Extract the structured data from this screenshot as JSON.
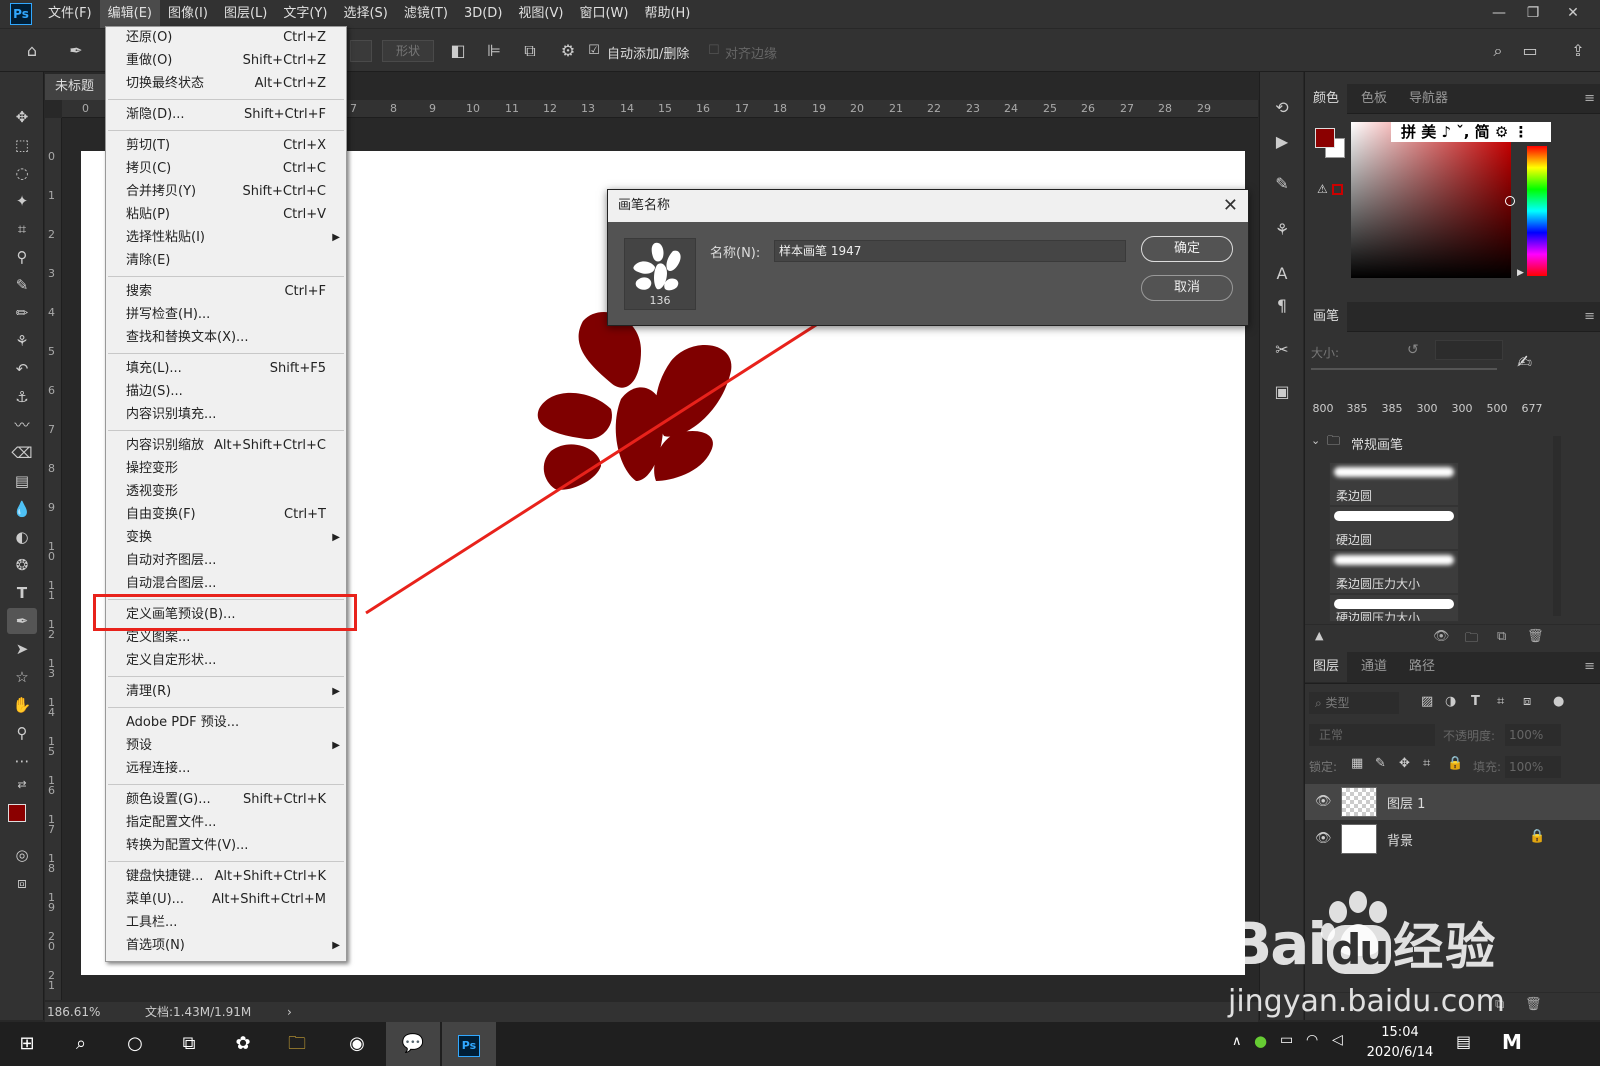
{
  "menubar": {
    "logo": "Ps",
    "items": [
      "文件(F)",
      "编辑(E)",
      "图像(I)",
      "图层(L)",
      "文字(Y)",
      "选择(S)",
      "滤镜(T)",
      "3D(D)",
      "视图(V)",
      "窗口(W)",
      "帮助(H)"
    ],
    "active_index": 1
  },
  "options": {
    "path_label": "形状",
    "auto_add_delete": "自动添加/删除",
    "align_edges": "对齐边缘"
  },
  "document": {
    "tab_title": "未标题",
    "zoom": "186.61%",
    "doc_info": "文档:1.43M/1.91M",
    "ruler_h": [
      "0",
      "7",
      "8",
      "9",
      "10",
      "11",
      "12",
      "13",
      "14",
      "15",
      "16",
      "17",
      "18",
      "19",
      "20",
      "21",
      "22",
      "23",
      "24",
      "25",
      "26",
      "27",
      "28",
      "29"
    ],
    "ruler_v": [
      "0",
      "1",
      "2",
      "3",
      "4",
      "5",
      "6",
      "7",
      "8",
      "9",
      "1 0",
      "1 1",
      "1 2",
      "1 3",
      "1 4",
      "1 5",
      "1 6",
      "1 7",
      "1 8",
      "1 9",
      "2 0",
      "2 1"
    ]
  },
  "edit_menu": {
    "groups": [
      [
        [
          "还原(O)",
          "Ctrl+Z"
        ],
        [
          "重做(O)",
          "Shift+Ctrl+Z"
        ],
        [
          "切换最终状态",
          "Alt+Ctrl+Z"
        ]
      ],
      [
        [
          "渐隐(D)...",
          "Shift+Ctrl+F"
        ]
      ],
      [
        [
          "剪切(T)",
          "Ctrl+X"
        ],
        [
          "拷贝(C)",
          "Ctrl+C"
        ],
        [
          "合并拷贝(Y)",
          "Shift+Ctrl+C"
        ],
        [
          "粘贴(P)",
          "Ctrl+V"
        ],
        [
          "选择性粘贴(I)",
          ""
        ],
        [
          "清除(E)",
          ""
        ]
      ],
      [
        [
          "搜索",
          "Ctrl+F"
        ],
        [
          "拼写检查(H)...",
          ""
        ],
        [
          "查找和替换文本(X)...",
          ""
        ]
      ],
      [
        [
          "填充(L)...",
          "Shift+F5"
        ],
        [
          "描边(S)...",
          ""
        ],
        [
          "内容识别填充...",
          ""
        ]
      ],
      [
        [
          "内容识别缩放",
          "Alt+Shift+Ctrl+C"
        ],
        [
          "操控变形",
          ""
        ],
        [
          "透视变形",
          ""
        ],
        [
          "自由变换(F)",
          "Ctrl+T"
        ],
        [
          "变换",
          ""
        ],
        [
          "自动对齐图层...",
          ""
        ],
        [
          "自动混合图层...",
          ""
        ]
      ],
      [
        [
          "定义画笔预设(B)...",
          ""
        ],
        [
          "定义图案...",
          ""
        ],
        [
          "定义自定形状...",
          ""
        ]
      ],
      [
        [
          "清理(R)",
          ""
        ]
      ],
      [
        [
          "Adobe PDF 预设...",
          ""
        ],
        [
          "预设",
          ""
        ],
        [
          "远程连接...",
          ""
        ]
      ],
      [
        [
          "颜色设置(G)...",
          "Shift+Ctrl+K"
        ],
        [
          "指定配置文件...",
          ""
        ],
        [
          "转换为配置文件(V)...",
          ""
        ]
      ],
      [
        [
          "键盘快捷键...",
          "Alt+Shift+Ctrl+K"
        ],
        [
          "菜单(U)...",
          "Alt+Shift+Ctrl+M"
        ],
        [
          "工具栏...",
          ""
        ],
        [
          "首选项(N)",
          ""
        ]
      ]
    ],
    "submenu_items": [
      "选择性粘贴(I)",
      "变换",
      "清理(R)",
      "预设",
      "首选项(N)"
    ],
    "highlighted": "定义画笔预设(B)..."
  },
  "dialog": {
    "title": "画笔名称",
    "name_label": "名称(N):",
    "name_value": "样本画笔 1947",
    "brush_size": "136",
    "ok": "确定",
    "cancel": "取消"
  },
  "color_panel": {
    "tabs": [
      "颜色",
      "色板",
      "导航器"
    ],
    "ime_bar": "拼 美 ♪ ˇ, 简 ⚙ ⋮",
    "fg_color": "#8b0000"
  },
  "brush_panel": {
    "title": "画笔",
    "size_label": "大小:",
    "preset_sizes": [
      "800",
      "385",
      "385",
      "300",
      "300",
      "500",
      "677"
    ],
    "group": "常规画笔",
    "brushes": [
      "柔边圆",
      "硬边圆",
      "柔边圆压力大小",
      "硬边圆压力大小"
    ]
  },
  "layers_panel": {
    "tabs": [
      "图层",
      "通道",
      "路径"
    ],
    "filter_label": "类型",
    "blend_mode": "正常",
    "opacity_label": "不透明度:",
    "opacity": "100%",
    "lock_label": "锁定:",
    "fill_label": "填充:",
    "fill": "100%",
    "layers": [
      "图层 1",
      "背景"
    ]
  },
  "taskbar": {
    "time": "15:04",
    "date": "2020/6/14"
  },
  "watermark": {
    "brand": "Bai",
    "brand2": "du",
    "cn": "经验",
    "url": "jingyan.baidu.com"
  },
  "colors": {
    "shape": "#7f0000",
    "highlight": "#e8221b"
  }
}
